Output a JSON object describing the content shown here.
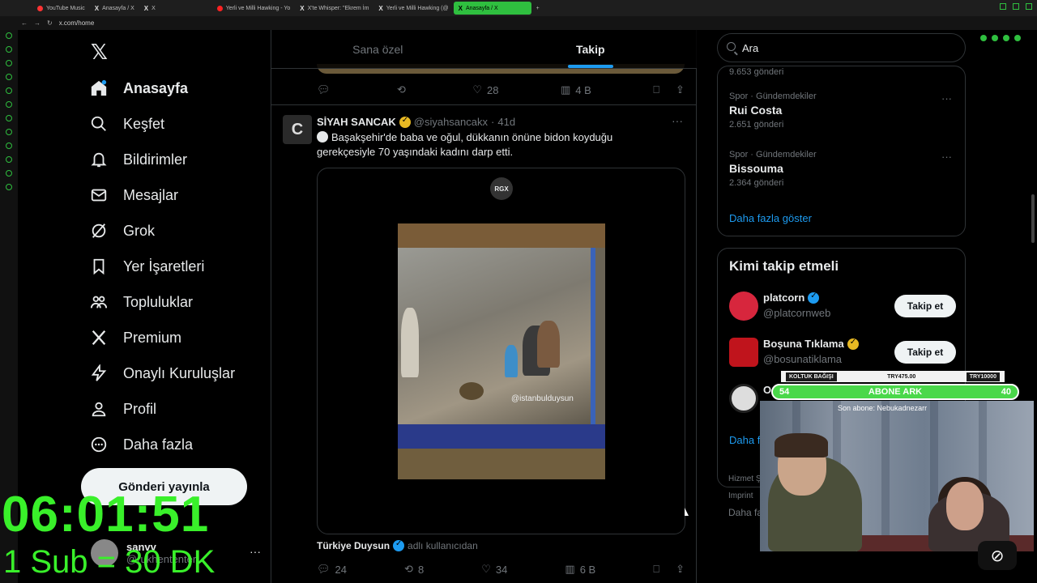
{
  "browser": {
    "tabs": [
      {
        "label": "YouTube Music"
      },
      {
        "label": "Anasayfa / X"
      },
      {
        "label": "X"
      },
      {
        "label": "Yerli ve Milli Hawking - Yo"
      },
      {
        "label": "X'te Whisper: \"Ekrem İm"
      },
      {
        "label": "Yerli ve Milli Hawking (@"
      },
      {
        "label": "Anasayfa / X",
        "active": true
      }
    ],
    "new_tab": "+",
    "url": "x.com/home",
    "accent": "#2fbf3f"
  },
  "nav": {
    "logo": "𝕏",
    "items": [
      {
        "label": "Anasayfa",
        "icon": "home-icon",
        "active": true
      },
      {
        "label": "Keşfet",
        "icon": "search-icon"
      },
      {
        "label": "Bildirimler",
        "icon": "bell-icon"
      },
      {
        "label": "Mesajlar",
        "icon": "mail-icon"
      },
      {
        "label": "Grok",
        "icon": "grok-icon"
      },
      {
        "label": "Yer İşaretleri",
        "icon": "bookmark-icon"
      },
      {
        "label": "Topluluklar",
        "icon": "communities-icon"
      },
      {
        "label": "Premium",
        "icon": "x-icon"
      },
      {
        "label": "Onaylı Kuruluşlar",
        "icon": "lightning-icon"
      },
      {
        "label": "Profil",
        "icon": "person-icon"
      },
      {
        "label": "Daha fazla",
        "icon": "more-circle-icon"
      }
    ],
    "post_button": "Gönderi yayınla",
    "account": {
      "name": "sanvv",
      "handle": "@rukhententer",
      "more": "···"
    }
  },
  "overlay": {
    "timer": "06:01:51",
    "sub_line": "1 Sub = 30 DK",
    "donation": {
      "label": "KOLTUK BAĞIŞI",
      "current": "TRY475.00",
      "goal": "TRY10000"
    },
    "sub_goal": {
      "left": "54",
      "label": "ABONE ARK",
      "right": "40"
    },
    "last_sub": "Son abone: Nebukadnezarr"
  },
  "timeline": {
    "tabs": [
      {
        "label": "Sana özel"
      },
      {
        "label": "Takip",
        "active": true
      }
    ],
    "prev_actions": {
      "reply": "",
      "retweet": "",
      "like": "28",
      "views": "4 B"
    },
    "tweet": {
      "avatar_glyph": "C",
      "name": "SİYAH SANCAK",
      "handle": "@siyahsancakx",
      "sep": "·",
      "time": "41d",
      "more": "···",
      "text": "Başakşehir'de baba ve oğul, dükkanın önüne bidon koyduğu gerekçesiyle 70 yaşındaki kadını darp etti.",
      "media_badge": "RGX",
      "watermark": "@istanbulduysun",
      "source_name": "Türkiye Duysun",
      "source_suffix": "adlı kullanıcıdan",
      "actions": {
        "reply": "24",
        "retweet": "8",
        "like": "34",
        "views": "6 B"
      }
    }
  },
  "right": {
    "search_placeholder": "Ara",
    "cut_count": "9.653 gönderi",
    "trends": [
      {
        "category": "Spor · Gündemdekiler",
        "title": "Rui Costa",
        "count": "2.651 gönderi"
      },
      {
        "category": "Spor · Gündemdekiler",
        "title": "Bissouma",
        "count": "2.364 gönderi"
      }
    ],
    "trend_more": "···",
    "show_more": "Daha fazla göster",
    "who_to_follow": {
      "title": "Kimi takip etmeli",
      "users": [
        {
          "name": "platcorn",
          "handle": "@platcornweb",
          "badge": "blue",
          "button": "Takip et",
          "color": "#d7263d"
        },
        {
          "name": "Boşuna Tıklama",
          "handle": "@bosunatiklama",
          "badge": "gold",
          "button": "Takip et",
          "color": "#c0141c"
        },
        {
          "name": "O",
          "handle": "",
          "badge": "",
          "button": "",
          "color": "#dddddd"
        }
      ],
      "show_more": "Daha f"
    },
    "footer": [
      "Hizmet Ş",
      "Imprint",
      "Daha fa"
    ]
  }
}
